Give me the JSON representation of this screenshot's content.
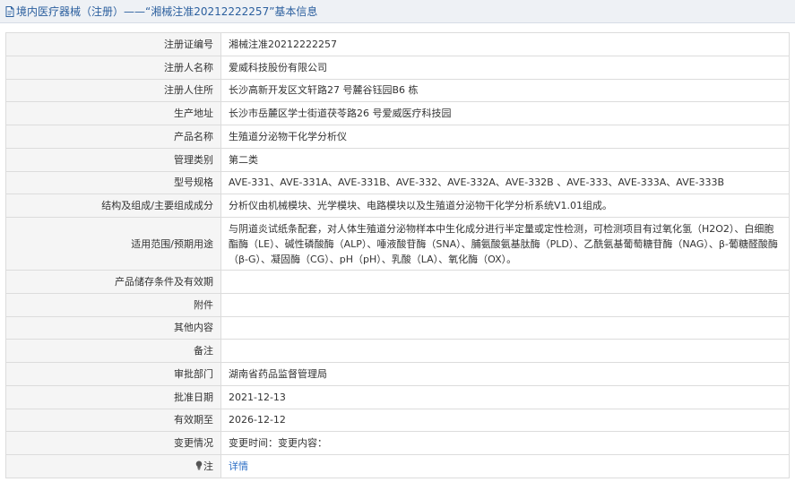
{
  "header": {
    "title": "境内医疗器械（注册）——“湘械注准20212222257”基本信息"
  },
  "rows": [
    {
      "label": "注册证编号",
      "value": "湘械注准20212222257"
    },
    {
      "label": "注册人名称",
      "value": "爱威科技股份有限公司"
    },
    {
      "label": "注册人住所",
      "value": "长沙高新开发区文轩路27 号麓谷钰园B6 栋"
    },
    {
      "label": "生产地址",
      "value": "长沙市岳麓区学士街道茯苓路26 号爱威医疗科技园"
    },
    {
      "label": "产品名称",
      "value": "生殖道分泌物干化学分析仪"
    },
    {
      "label": "管理类别",
      "value": "第二类"
    },
    {
      "label": "型号规格",
      "value": "AVE-331、AVE-331A、AVE-331B、AVE-332、AVE-332A、AVE-332B 、AVE-333、AVE-333A、AVE-333B"
    },
    {
      "label": "结构及组成/主要组成成分",
      "value": "分析仪由机械模块、光学模块、电路模块以及生殖道分泌物干化学分析系统V1.01组成。"
    },
    {
      "label": "适用范围/预期用途",
      "value": "与阴道炎试纸条配套，对人体生殖道分泌物样本中生化成分进行半定量或定性检测，可检测项目有过氧化氢（H2O2）、白细胞酯酶（LE）、碱性磷酸酶（ALP）、唾液酸苷酶（SNA）、脯氨酸氨基肽酶（PLD）、乙酰氨基葡萄糖苷酶（NAG）、β-葡糖醛酸酶（β-G）、凝固酶（CG）、pH（pH）、乳酸（LA）、氧化酶（OX）。"
    },
    {
      "label": "产品储存条件及有效期",
      "value": ""
    },
    {
      "label": "附件",
      "value": ""
    },
    {
      "label": "其他内容",
      "value": ""
    },
    {
      "label": "备注",
      "value": ""
    },
    {
      "label": "审批部门",
      "value": "湖南省药品监督管理局"
    },
    {
      "label": "批准日期",
      "value": "2021-12-13"
    },
    {
      "label": "有效期至",
      "value": "2026-12-12"
    },
    {
      "label": "变更情况",
      "value": "变更时间：变更内容："
    }
  ],
  "note_row": {
    "label": "注",
    "link_text": "详情"
  },
  "icons": {
    "header_icon": "document-icon",
    "note_icon": "lightbulb-icon"
  },
  "colors": {
    "header_text": "#2b5f9e",
    "link": "#2e6fc5",
    "label_bg": "#f5f5f5"
  }
}
